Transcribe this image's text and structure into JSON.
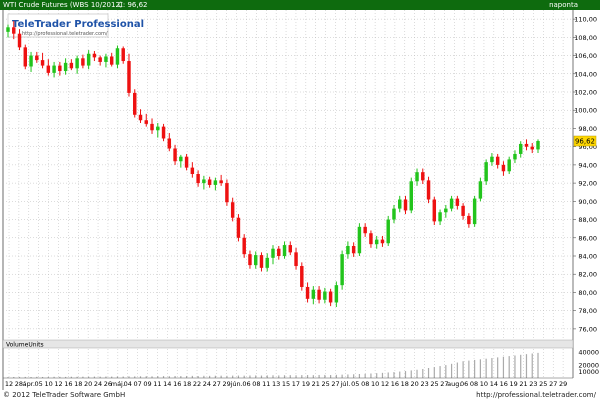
{
  "header": {
    "title": "WTI Crude Futures (WBS 10/2012)",
    "close_label": "C: 96,62",
    "period": "naponta"
  },
  "logo": {
    "brand": "TeleTrader Professional",
    "url": "http://professional.teletrader.com/"
  },
  "footer": {
    "copyright": "© 2012 TeleTrader Software GmbH",
    "url": "http://professional.teletrader.com/"
  },
  "volume_panel": {
    "label": "VolumeUnits",
    "ticks": [
      "40000",
      "20000",
      "10000"
    ]
  },
  "chart_data": {
    "type": "candlestick",
    "title": "WTI Crude Futures (WBS 10/2012)",
    "last_value_label": "96,62",
    "last_value": 96.62,
    "ylim": [
      75,
      111
    ],
    "y_ticks": [
      76,
      78,
      80,
      82,
      84,
      86,
      88,
      90,
      92,
      94,
      96,
      98,
      100,
      102,
      104,
      106,
      108,
      110
    ],
    "y_tick_labels": [
      "76,00",
      "78,00",
      "80,00",
      "82,00",
      "84,00",
      "86,00",
      "88,00",
      "90,00",
      "92,00",
      "94,00",
      "96,00",
      "98,00",
      "100,00",
      "102,00",
      "104,00",
      "106,00",
      "108,00",
      "110,00"
    ],
    "x_labels": [
      "12",
      "28",
      "ápr.",
      "05",
      "10",
      "12",
      "16",
      "18",
      "20",
      "24",
      "26",
      "máj.",
      "04",
      "07",
      "09",
      "11",
      "14",
      "16",
      "18",
      "22",
      "24",
      "27",
      "29",
      "jún.",
      "06",
      "08",
      "11",
      "13",
      "15",
      "17",
      "19",
      "21",
      "25",
      "27",
      "júl.",
      "05",
      "08",
      "10",
      "12",
      "16",
      "18",
      "20",
      "23",
      "25",
      "27",
      "aug.",
      "06",
      "08",
      "10",
      "14",
      "16",
      "19",
      "21",
      "23",
      "25",
      "27",
      "29"
    ],
    "grid": true,
    "colors": {
      "up": "#22c41c",
      "down": "#ee1111",
      "grid": "#b8b8b8",
      "header": "#0e6b0e",
      "last_value_bg": "#ffd700"
    },
    "ohlc": [
      [
        108.6,
        109.4,
        108.0,
        109.1
      ],
      [
        109.1,
        109.8,
        107.8,
        108.4
      ],
      [
        108.4,
        108.9,
        106.6,
        106.9
      ],
      [
        106.9,
        107.2,
        104.5,
        104.8
      ],
      [
        104.8,
        106.4,
        104.2,
        106.0
      ],
      [
        106.0,
        106.4,
        105.2,
        105.5
      ],
      [
        105.5,
        106.3,
        104.6,
        104.9
      ],
      [
        104.9,
        105.6,
        103.8,
        104.1
      ],
      [
        104.1,
        105.3,
        103.6,
        104.9
      ],
      [
        104.9,
        105.3,
        103.8,
        104.3
      ],
      [
        104.3,
        105.7,
        103.9,
        105.2
      ],
      [
        105.2,
        105.6,
        104.4,
        104.6
      ],
      [
        104.6,
        106.0,
        104.0,
        105.7
      ],
      [
        105.7,
        106.1,
        104.6,
        104.9
      ],
      [
        104.9,
        106.6,
        104.5,
        106.2
      ],
      [
        106.2,
        106.5,
        105.4,
        105.8
      ],
      [
        105.8,
        106.0,
        104.9,
        105.3
      ],
      [
        105.3,
        106.2,
        104.7,
        105.9
      ],
      [
        105.9,
        106.3,
        104.8,
        105.0
      ],
      [
        105.0,
        107.1,
        104.6,
        106.8
      ],
      [
        106.8,
        107.0,
        105.1,
        105.4
      ],
      [
        105.4,
        106.2,
        101.5,
        101.9
      ],
      [
        101.9,
        102.3,
        99.2,
        99.5
      ],
      [
        99.5,
        100.1,
        98.6,
        98.9
      ],
      [
        98.9,
        99.6,
        98.2,
        98.5
      ],
      [
        98.5,
        99.1,
        97.4,
        97.8
      ],
      [
        97.8,
        98.6,
        97.0,
        98.2
      ],
      [
        98.2,
        98.5,
        96.6,
        96.9
      ],
      [
        96.9,
        97.5,
        95.5,
        95.8
      ],
      [
        95.8,
        96.2,
        94.0,
        94.4
      ],
      [
        94.4,
        95.1,
        93.7,
        94.9
      ],
      [
        94.9,
        95.2,
        93.4,
        93.7
      ],
      [
        93.7,
        94.3,
        92.6,
        93.0
      ],
      [
        93.0,
        93.4,
        91.6,
        92.0
      ],
      [
        92.0,
        92.8,
        91.3,
        92.4
      ],
      [
        92.4,
        92.7,
        91.5,
        91.8
      ],
      [
        91.8,
        92.6,
        91.2,
        92.3
      ],
      [
        92.3,
        92.9,
        91.7,
        92.0
      ],
      [
        92.0,
        92.4,
        89.5,
        89.9
      ],
      [
        89.9,
        90.4,
        87.8,
        88.2
      ],
      [
        88.2,
        88.6,
        85.6,
        86.0
      ],
      [
        86.0,
        86.4,
        83.8,
        84.2
      ],
      [
        84.2,
        84.6,
        82.6,
        83.0
      ],
      [
        83.0,
        84.5,
        82.6,
        84.1
      ],
      [
        84.1,
        84.4,
        82.3,
        82.7
      ],
      [
        82.7,
        84.3,
        82.3,
        83.8
      ],
      [
        83.8,
        85.2,
        83.1,
        84.8
      ],
      [
        84.8,
        85.1,
        83.6,
        84.0
      ],
      [
        84.0,
        85.6,
        83.7,
        85.2
      ],
      [
        85.2,
        85.6,
        84.1,
        84.4
      ],
      [
        84.4,
        84.9,
        82.5,
        82.9
      ],
      [
        82.9,
        83.3,
        80.2,
        80.6
      ],
      [
        80.6,
        81.1,
        78.9,
        79.3
      ],
      [
        79.3,
        80.7,
        78.7,
        80.3
      ],
      [
        80.3,
        80.7,
        78.8,
        79.2
      ],
      [
        79.2,
        80.5,
        78.8,
        80.1
      ],
      [
        80.1,
        80.4,
        78.5,
        78.9
      ],
      [
        78.9,
        81.2,
        78.4,
        80.8
      ],
      [
        80.8,
        84.6,
        80.3,
        84.2
      ],
      [
        84.2,
        85.6,
        83.7,
        85.1
      ],
      [
        85.1,
        85.5,
        83.9,
        84.3
      ],
      [
        84.3,
        87.6,
        84.0,
        87.2
      ],
      [
        87.2,
        87.6,
        86.1,
        86.5
      ],
      [
        86.5,
        86.8,
        84.9,
        85.3
      ],
      [
        85.3,
        86.2,
        84.8,
        85.8
      ],
      [
        85.8,
        86.2,
        85.0,
        85.4
      ],
      [
        85.4,
        88.4,
        85.1,
        88.0
      ],
      [
        88.0,
        89.6,
        87.6,
        89.2
      ],
      [
        89.2,
        90.6,
        88.8,
        90.2
      ],
      [
        90.2,
        90.6,
        88.6,
        89.0
      ],
      [
        89.0,
        92.6,
        88.7,
        92.2
      ],
      [
        92.2,
        93.6,
        91.7,
        93.2
      ],
      [
        93.2,
        93.6,
        91.9,
        92.3
      ],
      [
        92.3,
        92.7,
        89.8,
        90.2
      ],
      [
        90.2,
        90.5,
        87.4,
        87.8
      ],
      [
        87.8,
        89.1,
        87.4,
        88.8
      ],
      [
        88.8,
        89.6,
        88.2,
        89.2
      ],
      [
        89.2,
        90.6,
        88.9,
        90.3
      ],
      [
        90.3,
        90.6,
        89.1,
        89.5
      ],
      [
        89.5,
        89.8,
        88.0,
        88.4
      ],
      [
        88.4,
        88.7,
        87.1,
        87.5
      ],
      [
        87.5,
        90.6,
        87.2,
        90.3
      ],
      [
        90.3,
        92.6,
        90.0,
        92.2
      ],
      [
        92.2,
        94.6,
        91.8,
        94.3
      ],
      [
        94.3,
        95.3,
        93.9,
        94.9
      ],
      [
        94.9,
        95.2,
        93.6,
        94.0
      ],
      [
        94.0,
        94.4,
        92.8,
        93.3
      ],
      [
        93.3,
        94.9,
        93.0,
        94.6
      ],
      [
        94.6,
        95.6,
        94.2,
        95.2
      ],
      [
        95.2,
        96.6,
        94.8,
        96.3
      ],
      [
        96.3,
        96.8,
        95.6,
        96.0
      ],
      [
        96.0,
        96.4,
        95.3,
        95.7
      ],
      [
        95.7,
        96.8,
        95.3,
        96.62
      ]
    ],
    "volume": [
      1400,
      1600,
      1500,
      1700,
      1500,
      1800,
      1600,
      1700,
      1900,
      1800,
      1700,
      2000,
      1900,
      2100,
      2000,
      2200,
      2100,
      2300,
      2200,
      2400,
      2300,
      2600,
      2500,
      2700,
      2800,
      2600,
      2900,
      3000,
      2800,
      3100,
      3000,
      3200,
      3300,
      3100,
      3400,
      3300,
      3500,
      3600,
      3400,
      3700,
      3800,
      3600,
      3900,
      4000,
      3800,
      4100,
      4200,
      4000,
      4300,
      4400,
      4200,
      4500,
      4600,
      4400,
      4700,
      4800,
      4600,
      4900,
      5200,
      5500,
      5800,
      6200,
      6500,
      7000,
      7500,
      8000,
      8600,
      9200,
      10000,
      10800,
      11800,
      12800,
      14000,
      15500,
      17000,
      18500,
      20000,
      22000,
      24000,
      26000,
      27000,
      28000,
      29000,
      30000,
      31000,
      32000,
      33000,
      34000,
      35000,
      36000,
      37000,
      38000,
      39000
    ]
  }
}
